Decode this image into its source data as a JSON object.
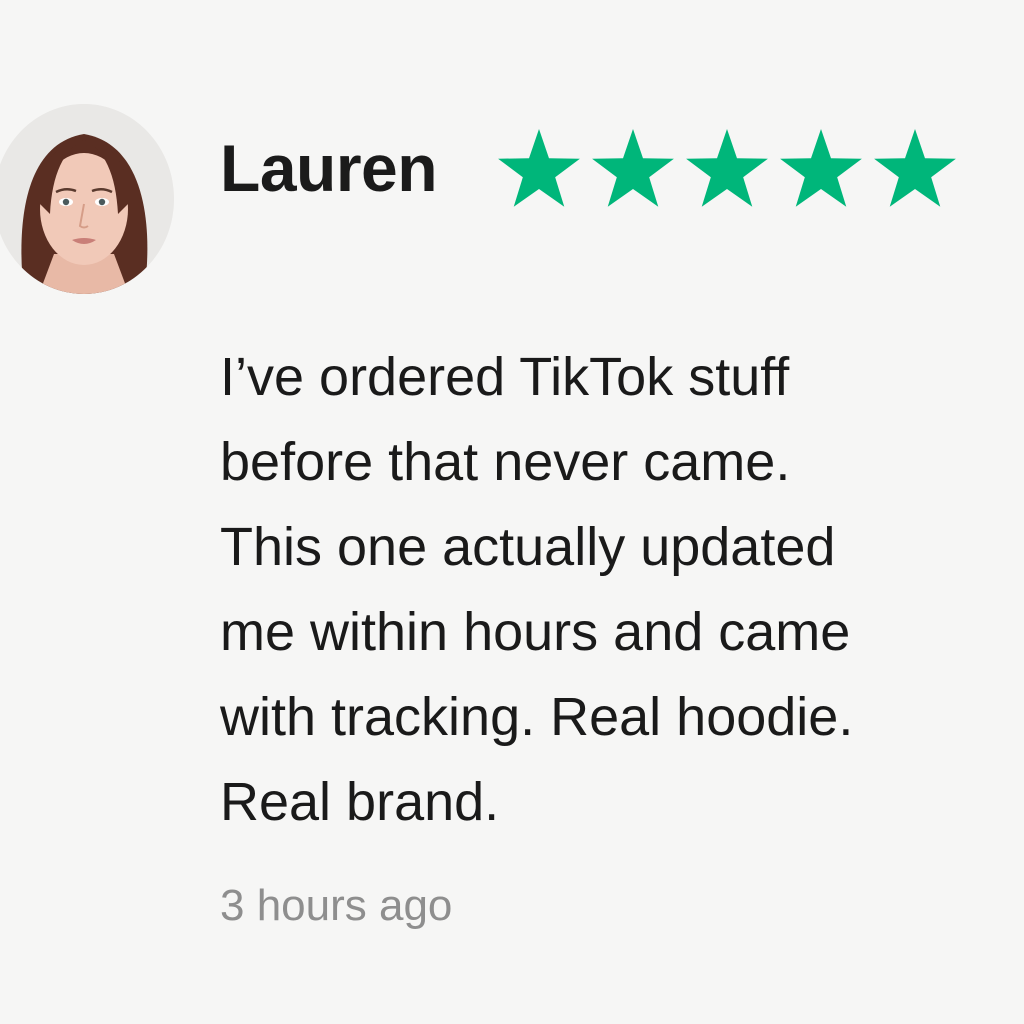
{
  "review": {
    "reviewer_name": "Lauren",
    "rating": 5,
    "rating_max": 5,
    "star_color": "#00b67a",
    "text_lines": [
      "I’ve ordered TikTok stuff",
      "before that never came.",
      "This one actually updated",
      "me within hours and came",
      "with tracking. Real hoodie.",
      "Real brand."
    ],
    "timestamp": "3 hours ago"
  }
}
